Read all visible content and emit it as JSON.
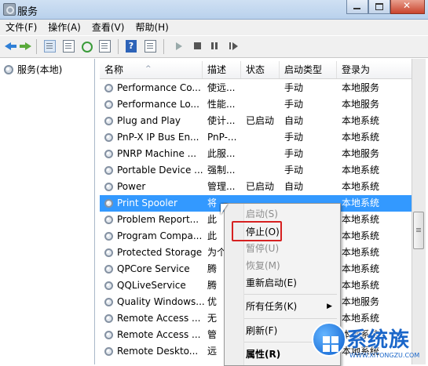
{
  "window": {
    "title": "服务",
    "controls": {
      "minimize": "minimize-icon",
      "maximize": "maximize-icon",
      "close": "close-icon"
    }
  },
  "menubar": {
    "items": [
      {
        "label": "文件(F)"
      },
      {
        "label": "操作(A)"
      },
      {
        "label": "查看(V)"
      },
      {
        "label": "帮助(H)"
      }
    ]
  },
  "toolbar": {
    "icons": [
      "back-arrow-icon",
      "forward-arrow-icon",
      "console-tree-icon",
      "properties-icon",
      "refresh-icon",
      "export-icon",
      "help-icon",
      "details-icon",
      "start-service-icon",
      "stop-service-icon",
      "pause-service-icon",
      "restart-service-icon"
    ],
    "help_glyph": "?"
  },
  "tree": {
    "root_label": "服务(本地)"
  },
  "table": {
    "columns": [
      "名称",
      "描述",
      "状态",
      "启动类型",
      "登录为"
    ],
    "sort_glyph": "^",
    "rows": [
      {
        "name": "Performance Co...",
        "desc": "使远...",
        "status": "",
        "startup": "手动",
        "logon": "本地服务"
      },
      {
        "name": "Performance Lo...",
        "desc": "性能...",
        "status": "",
        "startup": "手动",
        "logon": "本地服务"
      },
      {
        "name": "Plug and Play",
        "desc": "使计...",
        "status": "已启动",
        "startup": "自动",
        "logon": "本地系统"
      },
      {
        "name": "PnP-X IP Bus En...",
        "desc": "PnP-...",
        "status": "",
        "startup": "手动",
        "logon": "本地系统"
      },
      {
        "name": "PNRP Machine ...",
        "desc": "此服...",
        "status": "",
        "startup": "手动",
        "logon": "本地服务"
      },
      {
        "name": "Portable Device ...",
        "desc": "强制...",
        "status": "",
        "startup": "手动",
        "logon": "本地系统"
      },
      {
        "name": "Power",
        "desc": "管理...",
        "status": "已启动",
        "startup": "自动",
        "logon": "本地系统"
      },
      {
        "name": "Print Spooler",
        "desc": "将",
        "status": "",
        "startup": "",
        "logon": "本地系统"
      },
      {
        "name": "Problem Report...",
        "desc": "此",
        "status": "",
        "startup": "",
        "logon": "本地系统"
      },
      {
        "name": "Program Compa...",
        "desc": "此",
        "status": "",
        "startup": "",
        "logon": "本地系统"
      },
      {
        "name": "Protected Storage",
        "desc": "为个",
        "status": "",
        "startup": "",
        "logon": "本地系统"
      },
      {
        "name": "QPCore Service",
        "desc": "腾",
        "status": "",
        "startup": "",
        "logon": "本地系统"
      },
      {
        "name": "QQLiveService",
        "desc": "腾",
        "status": "",
        "startup": "",
        "logon": "本地系统"
      },
      {
        "name": "Quality Windows...",
        "desc": "优",
        "status": "",
        "startup": "",
        "logon": "本地服务"
      },
      {
        "name": "Remote Access ...",
        "desc": "无",
        "status": "",
        "startup": "",
        "logon": "本地系统"
      },
      {
        "name": "Remote Access ...",
        "desc": "管",
        "status": "",
        "startup": "",
        "logon": "本地系统"
      },
      {
        "name": "Remote Deskto...",
        "desc": "远",
        "status": "",
        "startup": "",
        "logon": "本地系统"
      }
    ],
    "selected_row": 7
  },
  "context_menu": {
    "items": [
      {
        "label": "启动(S)",
        "disabled": true
      },
      {
        "label": "停止(O)",
        "disabled": false
      },
      {
        "label": "暂停(U)",
        "disabled": true
      },
      {
        "label": "恢复(M)",
        "disabled": true
      },
      {
        "label": "重新启动(E)",
        "disabled": false
      },
      {
        "label": "所有任务(K)",
        "disabled": false,
        "submenu": "▶"
      },
      {
        "label": "刷新(F)",
        "disabled": false
      },
      {
        "label": "属性(R)",
        "disabled": false,
        "bold": true
      }
    ],
    "highlight_color": "#d62020"
  },
  "watermark": {
    "text": "系统族",
    "url": "WWW.XITONGZU.COM"
  },
  "colors": {
    "selection": "#3399ff",
    "titlebar": "#b9d1ec",
    "watermark": "#1a66c9"
  }
}
